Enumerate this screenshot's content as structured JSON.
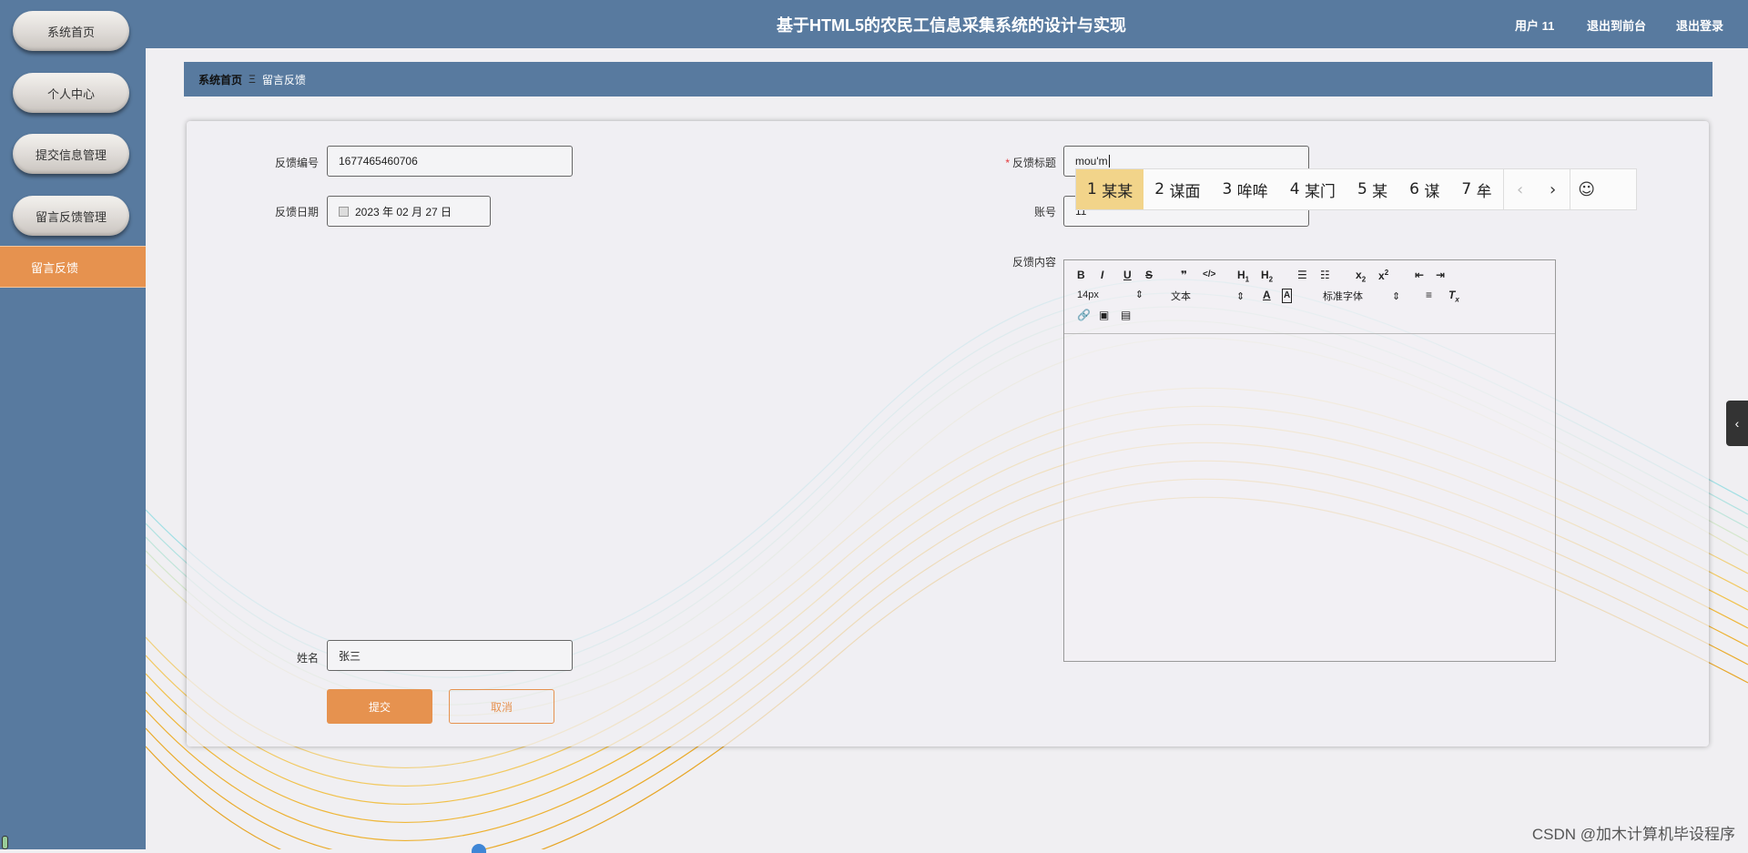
{
  "header": {
    "title": "基于HTML5的农民工信息采集系统的设计与实现",
    "user": "用户 11",
    "front_link": "退出到前台",
    "logout_link": "退出登录"
  },
  "sidebar": {
    "items": [
      {
        "label": "系统首页"
      },
      {
        "label": "个人中心"
      },
      {
        "label": "提交信息管理"
      },
      {
        "label": "留言反馈管理"
      }
    ],
    "active_item": "留言反馈"
  },
  "breadcrumb": {
    "home": "系统首页",
    "separator": "Ξ",
    "current": "留言反馈"
  },
  "form": {
    "feedback_no_label": "反馈编号",
    "feedback_no_value": "1677465460706",
    "feedback_date_label": "反馈日期",
    "feedback_date_value": "2023 年 02 月 27 日",
    "feedback_title_label": "反馈标题",
    "feedback_title_required": "*",
    "feedback_title_value": "mou'm",
    "account_label": "账号",
    "account_value": "11",
    "content_label": "反馈内容",
    "name_label": "姓名",
    "name_value": "张三",
    "submit_label": "提交",
    "cancel_label": "取消"
  },
  "editor": {
    "font_size": "14px",
    "block_format": "文本",
    "font_family": "标准字体"
  },
  "ime": {
    "candidates": [
      {
        "index": "1",
        "text": "某某"
      },
      {
        "index": "2",
        "text": "谋面"
      },
      {
        "index": "3",
        "text": "哞哞"
      },
      {
        "index": "4",
        "text": "某门"
      },
      {
        "index": "5",
        "text": "某"
      },
      {
        "index": "6",
        "text": "谋"
      },
      {
        "index": "7",
        "text": "牟"
      }
    ]
  },
  "watermark": "CSDN @加木计算机毕设程序",
  "colors": {
    "primary": "#587a9f",
    "accent": "#e6924f",
    "ime_highlight": "#f2d48a"
  }
}
